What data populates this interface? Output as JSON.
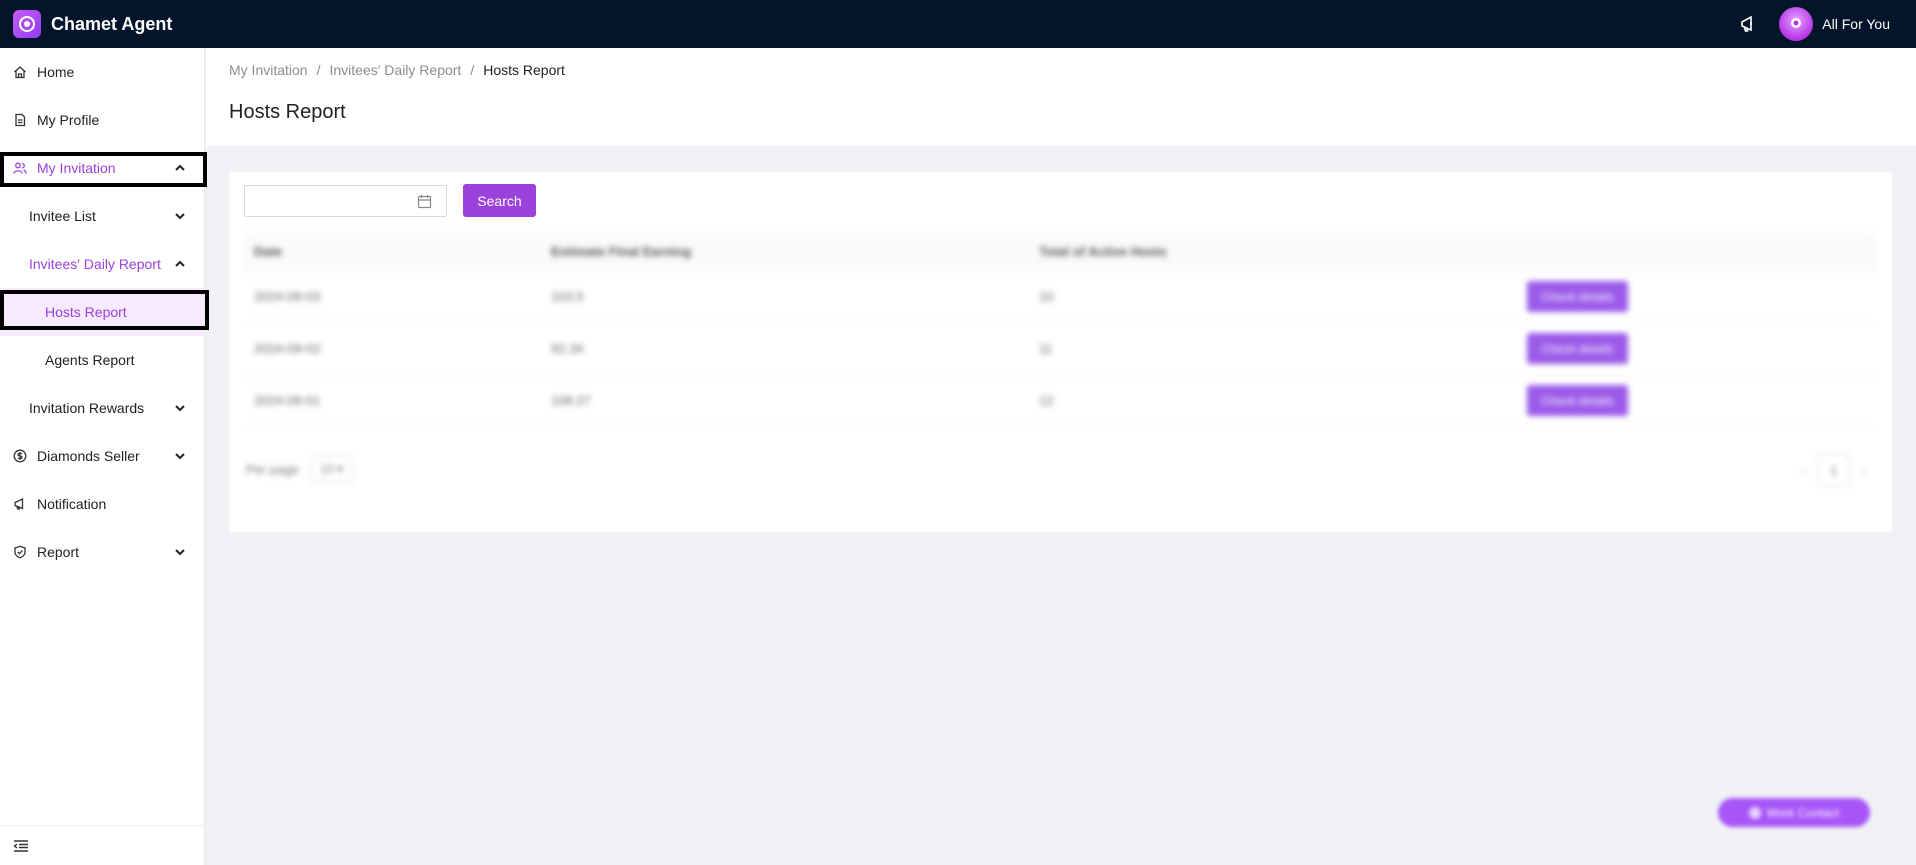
{
  "app": {
    "title": "Chamet Agent"
  },
  "user": {
    "name": "All For You"
  },
  "colors": {
    "topbar": "#03142b",
    "accent": "#9b42dc",
    "selected_bg": "#f7eafd"
  },
  "sidebar": {
    "items": [
      {
        "label": "Home",
        "icon": "home-icon"
      },
      {
        "label": "My Profile",
        "icon": "document-icon"
      },
      {
        "label": "My Invitation",
        "icon": "users-icon",
        "expanded": true,
        "highlighted": true
      },
      {
        "label": "Invitee List"
      },
      {
        "label": "Invitees' Daily Report",
        "expanded": true
      },
      {
        "label": "Hosts Report",
        "selected": true,
        "highlighted": true
      },
      {
        "label": "Agents Report"
      },
      {
        "label": "Invitation Rewards"
      },
      {
        "label": "Diamonds Seller",
        "icon": "dollar-circle-icon"
      },
      {
        "label": "Notification",
        "icon": "megaphone-icon"
      },
      {
        "label": "Report",
        "icon": "shield-check-icon"
      }
    ]
  },
  "breadcrumb": {
    "items": [
      "My Invitation",
      "Invitees' Daily Report",
      "Hosts Report"
    ],
    "separator": "/"
  },
  "page": {
    "title": "Hosts Report"
  },
  "search": {
    "date_value": "",
    "button_label": "Search"
  },
  "table": {
    "columns": [
      "Date",
      "Estimate Final Earning",
      "Total of Active Hosts",
      ""
    ],
    "rows": [
      {
        "date": "2024-09-03",
        "earning": "103.5",
        "hosts": "10",
        "action": "Check details"
      },
      {
        "date": "2024-09-02",
        "earning": "92.34",
        "hosts": "11",
        "action": "Check details"
      },
      {
        "date": "2024-09-01",
        "earning": "108.27",
        "hosts": "12",
        "action": "Check details"
      }
    ]
  },
  "pagination": {
    "per_page_label": "Per page",
    "page_size": "10",
    "current_page": "1"
  },
  "floating": {
    "label": "Work Contact"
  }
}
